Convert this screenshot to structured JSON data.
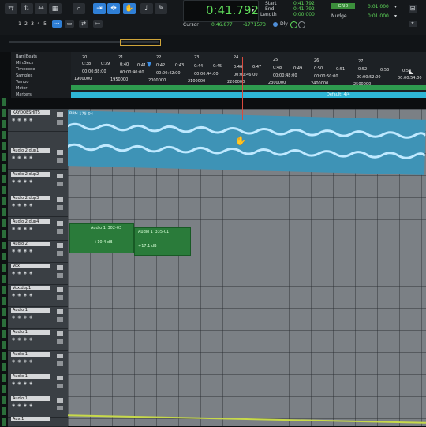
{
  "toolbar": {
    "track_numbers": [
      "1",
      "2",
      "3",
      "4",
      "5"
    ],
    "main_counter": "0:41.792",
    "start_label": "Start",
    "end_label": "End",
    "length_label": "Length",
    "start_value": "0:41.792",
    "end_value": "0:41.792",
    "length_value": "0:00.000",
    "cursor_label": "Cursor",
    "cursor_value": "0:46.877",
    "cursor_sample": "-1771573",
    "dly_label": "Dly",
    "grid_mode": "GRID",
    "grid_value": "0:01.000",
    "nudge_label": "Nudge",
    "nudge_value": "0:01.000"
  },
  "ruler": {
    "rows": [
      "Bars|Beats",
      "Min:Secs",
      "Timecode",
      "Samples",
      "Tempo",
      "Meter",
      "Markers"
    ],
    "bar_numbers": [
      "20",
      "21",
      "22",
      "23",
      "24",
      "25",
      "26",
      "27"
    ],
    "min_secs": [
      "0:38",
      "0:39",
      "0:40",
      "0:41",
      "0:42",
      "0:43",
      "0:44",
      "0:45",
      "0:46",
      "0:47",
      "0:48",
      "0:49",
      "0:50",
      "0:51",
      "0:52",
      "0:53",
      "0:54"
    ],
    "timecodes": [
      "00:00:38:00",
      "00:00:40:00",
      "00:00:42:00",
      "00:00:44:00",
      "00:00:46:00",
      "00:00:48:00",
      "00:00:50:00",
      "00:00:52:00",
      "00:00:54:00"
    ],
    "samples": [
      "1900000",
      "1950000",
      "2000000",
      "2100000",
      "2200000",
      "2300000",
      "2400000",
      "2500000"
    ],
    "meter_label": "Default: 4/4"
  },
  "tracks": [
    {
      "name": "KAYDOESHITS"
    },
    {
      "name": "Audio 2.dup1"
    },
    {
      "name": "Audio 2.dup2"
    },
    {
      "name": "Audio 2.dup3"
    },
    {
      "name": "Audio 2.dup4"
    },
    {
      "name": "Audio 2"
    },
    {
      "name": "Vox"
    },
    {
      "name": "Vox.dup1"
    },
    {
      "name": "Audio 1"
    },
    {
      "name": "Audio 1"
    },
    {
      "name": "Audio 1"
    },
    {
      "name": "Audio 1"
    },
    {
      "name": "Audio 1"
    },
    {
      "name": "Aux 1"
    }
  ],
  "clips": {
    "beat_clip": "BPM 175-04",
    "clip_a_name": "Audio 1_302-03",
    "clip_a_gain": "+10.4 dB",
    "clip_b_name": "Audio 1_335-01",
    "clip_b_gain": "+17.1 dB"
  },
  "colors": {
    "accent": "#2f7fd6",
    "counter_green": "#5fdc5a",
    "clip_blue": "#3e93b6",
    "clip_green": "#2a7b3a",
    "playhead": "#d94a3e",
    "tempo_green": "#2e9b4f",
    "meter_cyan": "#2eb6d6"
  }
}
